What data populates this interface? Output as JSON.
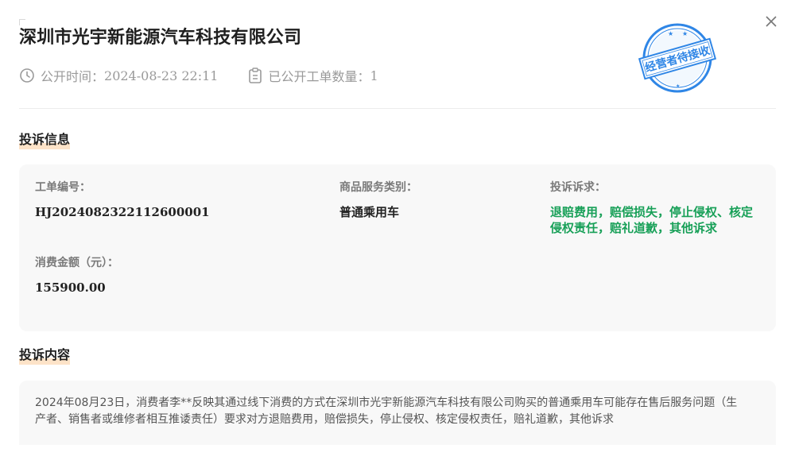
{
  "header": {
    "company_name": "深圳市光宇新能源汽车科技有限公司",
    "publish_time_label": "公开时间：",
    "publish_time": "2024-08-23 22:11",
    "ticket_count_label": "已公开工单数量：",
    "ticket_count": "1",
    "stamp_text": "经营者待接收"
  },
  "complaint_info": {
    "section_title": "投诉信息",
    "ticket_no_label": "工单编号：",
    "ticket_no": "HJ2024082322112600001",
    "category_label": "商品服务类别：",
    "category": "普通乘用车",
    "appeal_label": "投诉诉求：",
    "appeal": "退赔费用，赔偿损失，停止侵权、核定侵权责任，赔礼道歉，其他诉求",
    "amount_label": "消费金额（元）：",
    "amount": "155900.00"
  },
  "complaint_content": {
    "section_title": "投诉内容",
    "text": "2024年08月23日，消费者李**反映其通过线下消费的方式在深圳市光宇新能源汽车科技有限公司购买的普通乘用车可能存在售后服务问题（生产者、销售者或维修者相互推诿责任）要求对方退赔费用，赔偿损失，停止侵权、核定侵权责任，赔礼道歉，其他诉求"
  },
  "colors": {
    "accent_green": "#18a058",
    "stamp_blue": "#2f86e6",
    "section_highlight": "#fde3c8"
  }
}
